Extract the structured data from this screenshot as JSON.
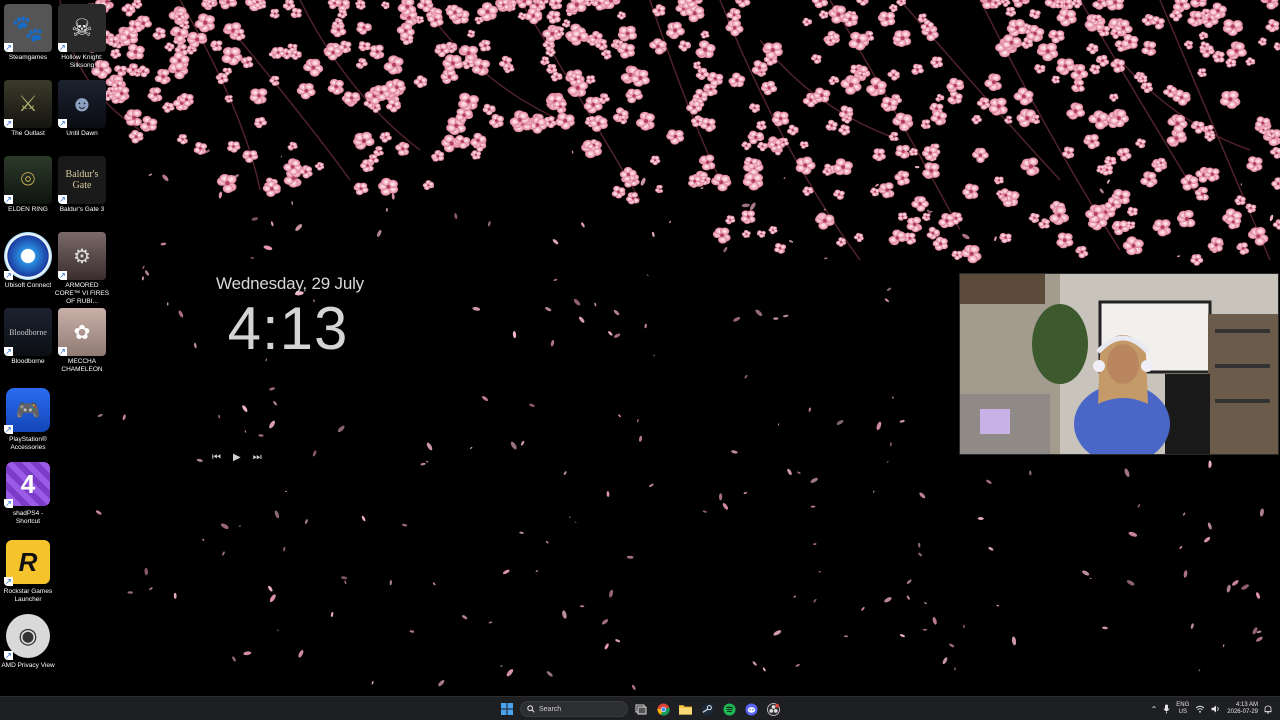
{
  "desktop": {
    "icons": [
      {
        "label": "Steamgames",
        "icon": "paw-icon"
      },
      {
        "label": "Hollow Knight: Silksong",
        "icon": "skull-icon"
      },
      {
        "label": "The Outlast",
        "icon": "outlast-icon"
      },
      {
        "label": "Until Dawn",
        "icon": "until-dawn-icon"
      },
      {
        "label": "ELDEN RING",
        "icon": "elden-ring-icon"
      },
      {
        "label": "Baldur's Gate 3",
        "icon": "baldurs-gate-icon"
      },
      {
        "label": "Ubisoft Connect",
        "icon": "ubisoft-icon"
      },
      {
        "label": "ARMORED CORE™ VI FIRES OF RUBI...",
        "icon": "armored-core-icon"
      },
      {
        "label": "Bloodborne",
        "icon": "bloodborne-icon"
      },
      {
        "label": "MECCHA CHAMELEON",
        "icon": "meccha-chameleon-icon"
      },
      {
        "label": "PlayStation® Accessories",
        "icon": "playstation-controller-icon"
      },
      {
        "label": "shadPS4 - Shortcut",
        "icon": "shadps4-icon"
      },
      {
        "label": "Rockstar Games Launcher",
        "icon": "rockstar-icon"
      },
      {
        "label": "AMD Privacy View",
        "icon": "amd-privacy-icon"
      }
    ]
  },
  "clock_widget": {
    "date": "Wednesday, 29 July",
    "time": "4:13",
    "controls": {
      "prev": "⏮",
      "play": "▶",
      "next": "⏭"
    }
  },
  "taskbar": {
    "search_placeholder": "Search",
    "apps": [
      "start-icon",
      "search-icon",
      "task-view-icon",
      "chrome-icon",
      "file-explorer-icon",
      "steam-icon",
      "spotify-icon",
      "discord-icon",
      "obs-icon"
    ],
    "tray": {
      "language_line1": "ENG",
      "language_line2": "US",
      "time": "4:13 AM",
      "date": "2026-07-29"
    }
  },
  "colors": {
    "blossom": "#f4b6c6",
    "blossom_dark": "#d97a93",
    "taskbar_bg": "#1e1f22"
  }
}
